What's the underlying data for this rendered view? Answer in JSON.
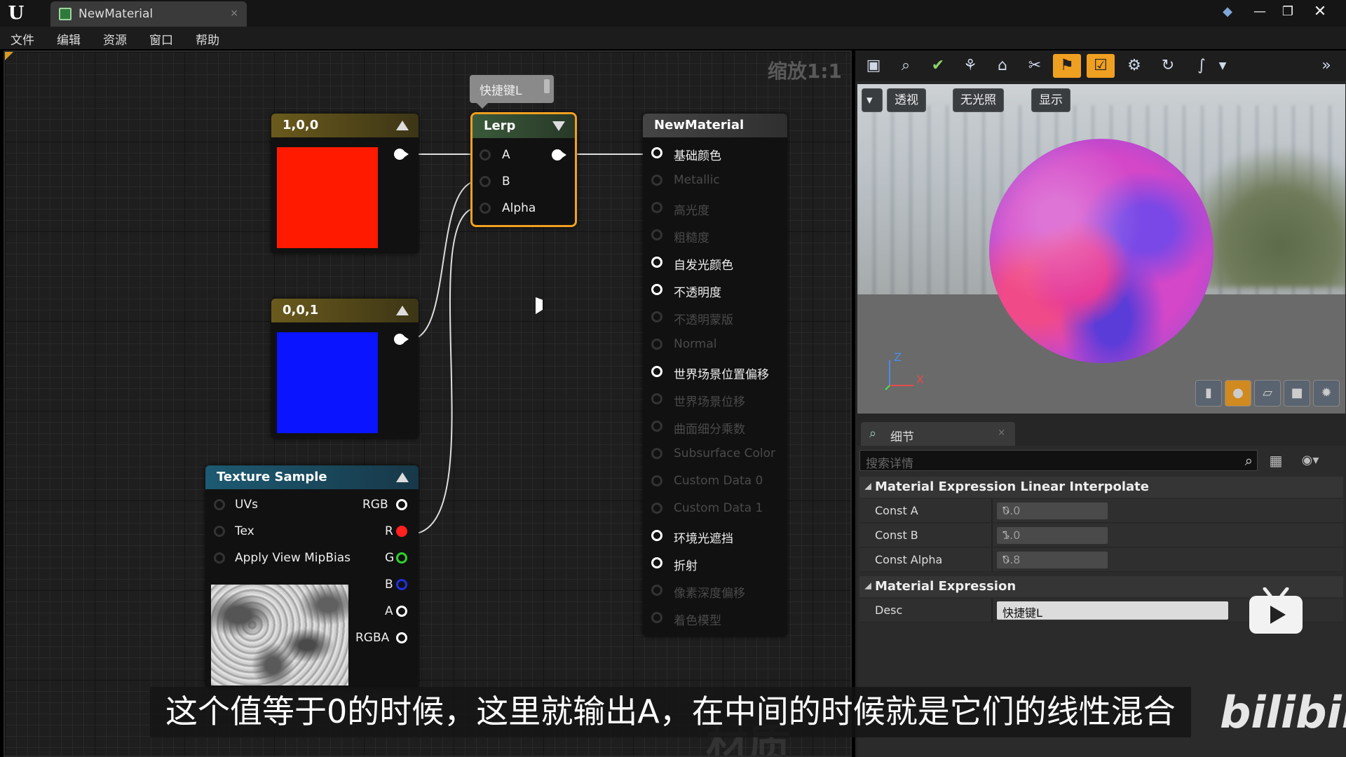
{
  "title_bar": {
    "tab_label": "NewMaterial",
    "tab_close": "×",
    "logo": "U"
  },
  "menu": [
    "文件",
    "编辑",
    "资源",
    "窗口",
    "帮助"
  ],
  "graph": {
    "zoom_label": "缩放1:1",
    "comment_bubble": "快捷键L",
    "const_red": {
      "title": "1,0,0",
      "color": "#ff1a00"
    },
    "const_blue": {
      "title": "0,0,1",
      "color": "#0a14ff"
    },
    "lerp": {
      "title": "Lerp",
      "inputs": [
        "A",
        "B",
        "Alpha"
      ]
    },
    "texture_sample": {
      "title": "Texture Sample",
      "inputs": [
        "UVs",
        "Tex",
        "Apply View MipBias"
      ],
      "outputs": [
        "RGB",
        "R",
        "G",
        "B",
        "A",
        "RGBA"
      ]
    },
    "material": {
      "title": "NewMaterial",
      "inputs": [
        {
          "label": "基础颜色",
          "active": true
        },
        {
          "label": "Metallic",
          "active": false
        },
        {
          "label": "高光度",
          "active": false
        },
        {
          "label": "粗糙度",
          "active": false
        },
        {
          "label": "自发光颜色",
          "active": true
        },
        {
          "label": "不透明度",
          "active": true
        },
        {
          "label": "不透明蒙版",
          "active": false
        },
        {
          "label": "Normal",
          "active": false
        },
        {
          "label": "世界场景位置偏移",
          "active": true
        },
        {
          "label": "世界场景位移",
          "active": false
        },
        {
          "label": "曲面细分乘数",
          "active": false
        },
        {
          "label": "Subsurface Color",
          "active": false
        },
        {
          "label": "Custom Data 0",
          "active": false
        },
        {
          "label": "Custom Data 1",
          "active": false
        },
        {
          "label": "环境光遮挡",
          "active": true
        },
        {
          "label": "折射",
          "active": true
        },
        {
          "label": "像素深度偏移",
          "active": false
        },
        {
          "label": "着色模型",
          "active": false
        }
      ]
    },
    "watermark": "材质"
  },
  "subtitle": "这个值等于0的时候，这里就输出A，在中间的时候就是它们的线性混合",
  "bili_logo": "bilibili",
  "viewport": {
    "buttons": [
      "透视",
      "无光照",
      "显示"
    ],
    "axis_z": "Z",
    "axis_x": "X"
  },
  "details": {
    "tab_label": "细节",
    "search_placeholder": "搜索详情",
    "section1": {
      "title": "Material Expression Linear Interpolate",
      "rows": [
        {
          "name": "Const A",
          "value": "0.0"
        },
        {
          "name": "Const B",
          "value": "1.0"
        },
        {
          "name": "Const Alpha",
          "value": "0.8"
        }
      ]
    },
    "section2": {
      "title": "Material Expression",
      "desc_label": "Desc",
      "desc_value": "快捷键L"
    }
  },
  "colors": {
    "accent": "#f0a020",
    "lerp_border": "#f0a020"
  }
}
